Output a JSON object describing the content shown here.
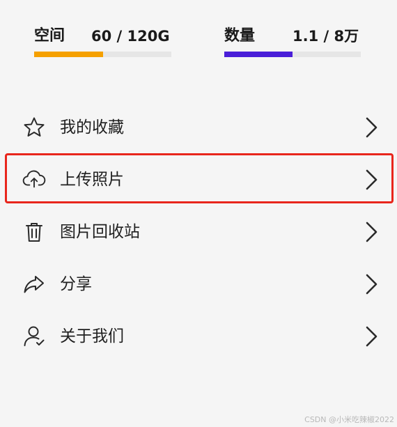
{
  "stats": {
    "space": {
      "label": "空间",
      "value": "60 / 120G",
      "progress": 0.5,
      "color": "#f5a000"
    },
    "count": {
      "label": "数量",
      "value": "1.1 / 8万",
      "progress": 0.5,
      "color": "#4a1ed8"
    }
  },
  "menu": {
    "items": [
      {
        "label": "我的收藏",
        "icon": "star-icon"
      },
      {
        "label": "上传照片",
        "icon": "cloud-upload-icon",
        "highlighted": true
      },
      {
        "label": "图片回收站",
        "icon": "trash-icon"
      },
      {
        "label": "分享",
        "icon": "share-icon"
      },
      {
        "label": "关于我们",
        "icon": "user-check-icon"
      }
    ],
    "highlight_color": "#e8261c"
  },
  "watermark": "CSDN @小米吃辣椒2022"
}
